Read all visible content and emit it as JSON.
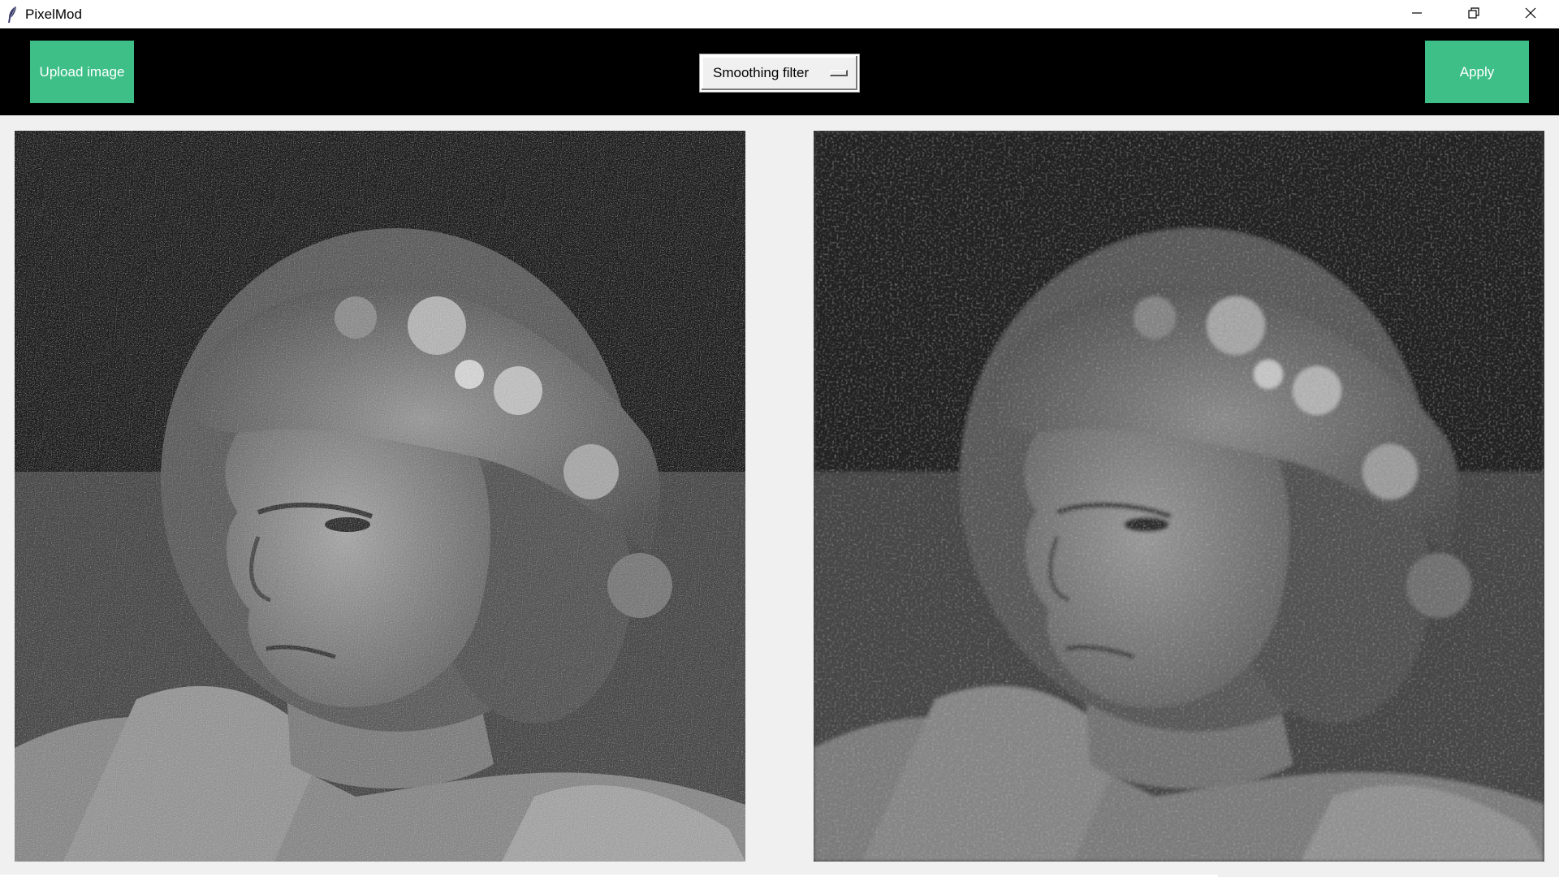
{
  "window": {
    "title": "PixelMod",
    "app_icon": "feather-icon",
    "controls": [
      "minimize-icon",
      "restore-icon",
      "close-icon"
    ]
  },
  "toolbar": {
    "upload_label": "Upload image",
    "filter_selected": "Smoothing filter",
    "apply_label": "Apply",
    "accent_color": "#3ebf88"
  },
  "images": {
    "original_alt": "",
    "processed_alt": ""
  }
}
